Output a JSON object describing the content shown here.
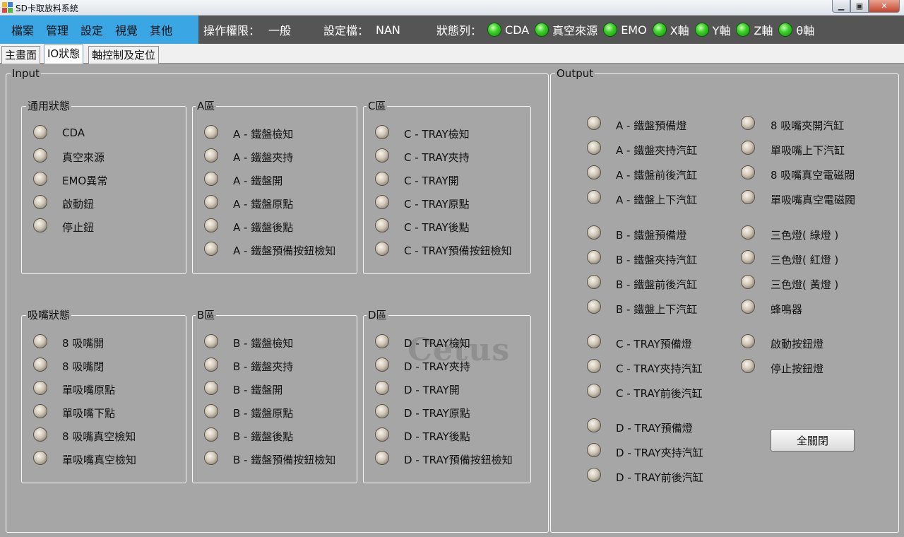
{
  "window": {
    "title": "SD卡取放料系統"
  },
  "menu": {
    "items": [
      "檔案",
      "管理",
      "設定",
      "視覺",
      "其他"
    ]
  },
  "status_strip": {
    "permission_label": "操作權限：",
    "permission_value": "一般",
    "config_label": "設定檔：",
    "config_value": "NAN",
    "status_label": "狀態列：",
    "leds": [
      "CDA",
      "真空來源",
      "EMO",
      "X軸",
      "Y軸",
      "Z軸",
      "θ軸"
    ],
    "led_color": "#3dd12b"
  },
  "tabs": [
    "主畫面",
    "IO狀態",
    "軸控制及定位"
  ],
  "active_tab": "IO狀態",
  "input": {
    "title": "Input",
    "groups": [
      {
        "title": "通用狀態",
        "items": [
          "CDA",
          "真空來源",
          "EMO異常",
          "啟動鈕",
          "停止鈕"
        ]
      },
      {
        "title": "A區",
        "items": [
          "A - 鐵盤檢知",
          "A - 鐵盤夾持",
          "A - 鐵盤開",
          "A - 鐵盤原點",
          "A - 鐵盤後點",
          "A - 鐵盤預備按鈕檢知"
        ]
      },
      {
        "title": "C區",
        "items": [
          "C - TRAY檢知",
          "C - TRAY夾持",
          "C - TRAY開",
          "C - TRAY原點",
          "C - TRAY後點",
          "C - TRAY預備按鈕檢知"
        ]
      },
      {
        "title": "吸嘴狀態",
        "items": [
          "8 吸嘴開",
          "8 吸嘴閉",
          "單吸嘴原點",
          "單吸嘴下點",
          "8 吸嘴真空檢知",
          "單吸嘴真空檢知"
        ]
      },
      {
        "title": "B區",
        "items": [
          "B - 鐵盤檢知",
          "B - 鐵盤夾持",
          "B - 鐵盤開",
          "B - 鐵盤原點",
          "B - 鐵盤後點",
          "B - 鐵盤預備按鈕檢知"
        ]
      },
      {
        "title": "D區",
        "items": [
          "D - TRAY檢知",
          "D - TRAY夾持",
          "D - TRAY開",
          "D - TRAY原點",
          "D - TRAY後點",
          "D - TRAY預備按鈕檢知"
        ]
      }
    ]
  },
  "watermark": "Cetus",
  "output": {
    "title": "Output",
    "left_column": [
      [
        "A - 鐵盤預備燈",
        "A - 鐵盤夾持汽缸",
        "A - 鐵盤前後汽缸",
        "A - 鐵盤上下汽缸"
      ],
      [
        "B - 鐵盤預備燈",
        "B - 鐵盤夾持汽缸",
        "B - 鐵盤前後汽缸",
        "B - 鐵盤上下汽缸"
      ],
      [
        "C - TRAY預備燈",
        "C - TRAY夾持汽缸",
        "C - TRAY前後汽缸"
      ],
      [
        "D - TRAY預備燈",
        "D - TRAY夾持汽缸",
        "D - TRAY前後汽缸"
      ]
    ],
    "right_column": [
      [
        "8 吸嘴夾開汽缸",
        "單吸嘴上下汽缸",
        "8 吸嘴真空電磁閥",
        "單吸嘴真空電磁閥"
      ],
      [
        "三色燈( 綠燈 )",
        "三色燈( 紅燈 )",
        "三色燈( 黃燈 )",
        "蜂鳴器"
      ],
      [
        "啟動按鈕燈",
        "停止按鈕燈"
      ]
    ],
    "all_off_button": "全關閉"
  }
}
